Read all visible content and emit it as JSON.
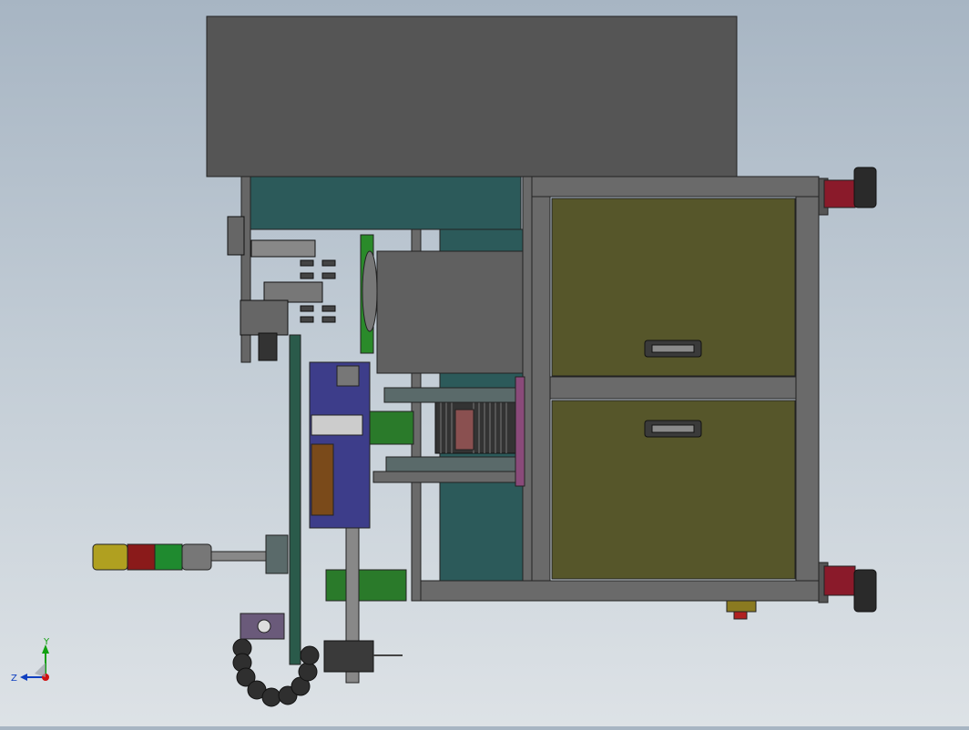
{
  "viewport": {
    "label": "",
    "background_top": "#a7b5c3",
    "background_bottom": "#dde2e6"
  },
  "triad": {
    "x_label": "",
    "y_label": "Y",
    "z_label": "Z",
    "colors": {
      "x": "#d01010",
      "y": "#10a010",
      "z": "#1040c0"
    }
  },
  "colors": {
    "dark_panel": "#555555",
    "teal_panel": "#2c5a5a",
    "drawer_olive": "#56562a",
    "frame_grey": "#6a6a6a",
    "purple_plate": "#3d3d8a",
    "brown_block": "#7a4a1a",
    "light_green": "#2a8a2a",
    "lamp_yellow": "#b0a020",
    "lamp_red": "#8a1a1a",
    "lamp_green": "#1f8a2f",
    "caster_red": "#8a1a2a"
  }
}
